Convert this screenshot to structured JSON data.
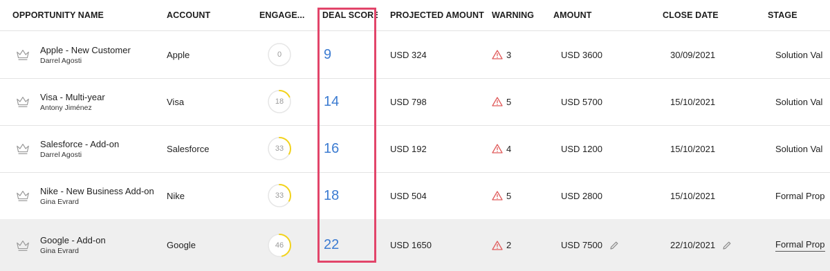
{
  "headers": {
    "opportunity_name": "OPPORTUNITY NAME",
    "account": "ACCOUNT",
    "engagement": "ENGAGE...",
    "deal_score": "DEAL SCORE",
    "projected_amount": "PROJECTED AMOUNT",
    "warning": "WARNING",
    "amount": "AMOUNT",
    "close_date": "CLOSE DATE",
    "stage": "STAGE"
  },
  "rows": [
    {
      "name": "Apple - New Customer",
      "owner": "Darrel Agosti",
      "account": "Apple",
      "engagement": "0",
      "deal_score": "9",
      "projected_amount": "USD 324",
      "warnings": "3",
      "amount": "USD 3600",
      "close_date": "30/09/2021",
      "stage": "Solution Val"
    },
    {
      "name": "Visa - Multi-year",
      "owner": "Antony Jiménez",
      "account": "Visa",
      "engagement": "18",
      "deal_score": "14",
      "projected_amount": "USD 798",
      "warnings": "5",
      "amount": "USD 5700",
      "close_date": "15/10/2021",
      "stage": "Solution Val"
    },
    {
      "name": "Salesforce - Add-on",
      "owner": "Darrel Agosti",
      "account": "Salesforce",
      "engagement": "33",
      "deal_score": "16",
      "projected_amount": "USD 192",
      "warnings": "4",
      "amount": "USD 1200",
      "close_date": "15/10/2021",
      "stage": "Solution Val"
    },
    {
      "name": "Nike - New Business Add-on",
      "owner": "Gina Evrard",
      "account": "Nike",
      "engagement": "33",
      "deal_score": "18",
      "projected_amount": "USD 504",
      "warnings": "5",
      "amount": "USD 2800",
      "close_date": "15/10/2021",
      "stage": "Formal Prop"
    },
    {
      "name": "Google - Add-on",
      "owner": "Gina Evrard",
      "account": "Google",
      "engagement": "46",
      "deal_score": "22",
      "projected_amount": "USD 1650",
      "warnings": "2",
      "amount": "USD 7500",
      "close_date": "22/10/2021",
      "stage": "Formal Prop"
    }
  ],
  "colors": {
    "score": "#3b7bd1",
    "ring_progress": "#f2d21b",
    "ring_track": "#e6e6e6",
    "warning": "#e05a5a",
    "highlight": "#e2456a",
    "selected_row": "#efefef"
  },
  "icons": {
    "row_icon": "crown-icon",
    "warning": "warning-triangle-icon",
    "edit": "pencil-icon"
  }
}
